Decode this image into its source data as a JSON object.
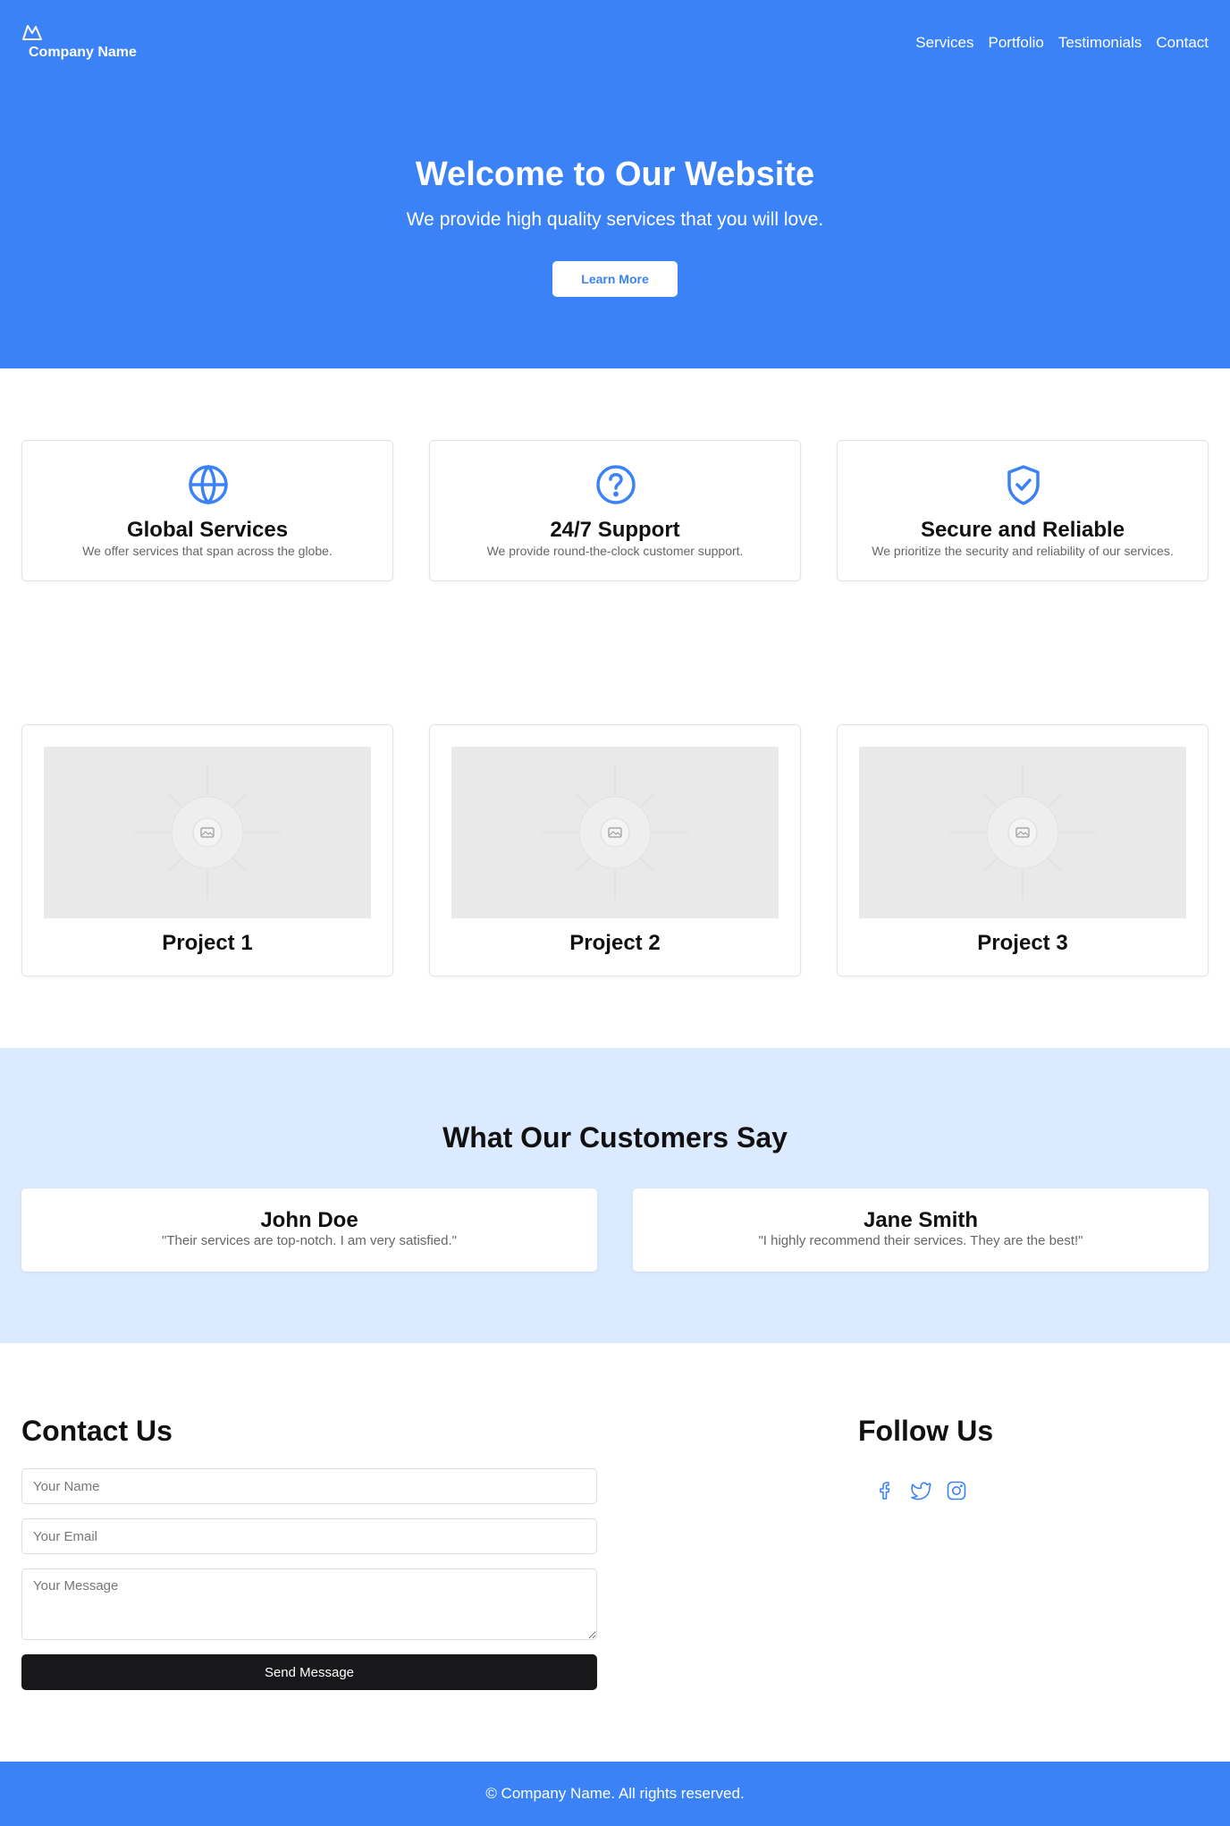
{
  "brand": {
    "name": "Company Name",
    "logo_icon": "mountain-icon"
  },
  "nav": {
    "items": [
      "Services",
      "Portfolio",
      "Testimonials",
      "Contact"
    ]
  },
  "hero": {
    "title": "Welcome to Our Website",
    "subtitle": "We provide high quality services that you will love.",
    "button_label": "Learn More"
  },
  "features": [
    {
      "icon": "globe-icon",
      "title": "Global Services",
      "description": "We offer services that span across the globe."
    },
    {
      "icon": "help-circle-icon",
      "title": "24/7 Support",
      "description": "We provide round-the-clock customer support."
    },
    {
      "icon": "shield-check-icon",
      "title": "Secure and Reliable",
      "description": "We prioritize the security and reliability of our services."
    }
  ],
  "projects": [
    {
      "title": "Project 1",
      "image_icon": "image-placeholder-icon"
    },
    {
      "title": "Project 2",
      "image_icon": "image-placeholder-icon"
    },
    {
      "title": "Project 3",
      "image_icon": "image-placeholder-icon"
    }
  ],
  "testimonials": {
    "heading": "What Our Customers Say",
    "items": [
      {
        "name": "John Doe",
        "quote": "\"Their services are top-notch. I am very satisfied.\""
      },
      {
        "name": "Jane Smith",
        "quote": "\"I highly recommend their services. They are the best!\""
      }
    ]
  },
  "contact": {
    "title": "Contact Us",
    "name_placeholder": "Your Name",
    "email_placeholder": "Your Email",
    "message_placeholder": "Your Message",
    "button_label": "Send Message"
  },
  "follow": {
    "title": "Follow Us",
    "icons": [
      "facebook-icon",
      "twitter-icon",
      "instagram-icon"
    ]
  },
  "footer": {
    "text": "© Company Name. All rights reserved."
  },
  "colors": {
    "primary": "#3b82f6",
    "light_blue": "#dbeafe",
    "dark_button": "#18181b",
    "placeholder_bg": "#e9e9e9"
  }
}
